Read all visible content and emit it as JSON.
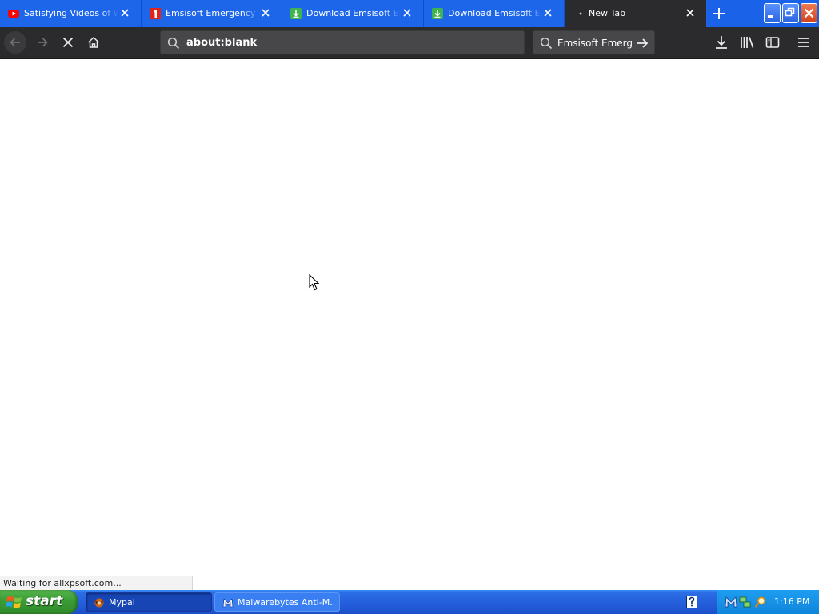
{
  "browser": {
    "tabs": [
      {
        "title": "Satisfying Videos of Wor",
        "favicon": "youtube-icon",
        "active": false
      },
      {
        "title": "Emsisoft Emergency Kit",
        "favicon": "emsisoft-icon",
        "active": false
      },
      {
        "title": "Download Emsisoft Emer",
        "favicon": "download-site-icon",
        "active": false
      },
      {
        "title": "Download Emsisoft Emer",
        "favicon": "download-site-icon",
        "active": false
      },
      {
        "title": "New Tab",
        "favicon": "loading-dot-icon",
        "active": true
      }
    ],
    "url": "about:blank",
    "search_text": "Emsisoft Emergency",
    "status_text": "Waiting for allxpsoft.com..."
  },
  "taskbar": {
    "start_label": "start",
    "items": [
      {
        "label": "Mypal",
        "icon": "mypal-icon",
        "active": true
      },
      {
        "label": "Malwarebytes Anti-M...",
        "icon": "malwarebytes-icon",
        "active": false
      }
    ],
    "clock": "1:16 PM"
  },
  "colors": {
    "tab_strip": "#1a63e8",
    "toolbar": "#2b2b2e",
    "urlbar": "#474749",
    "taskbar": "#245ddb",
    "start_button": "#3b9c36",
    "tray": "#0f85dc"
  }
}
